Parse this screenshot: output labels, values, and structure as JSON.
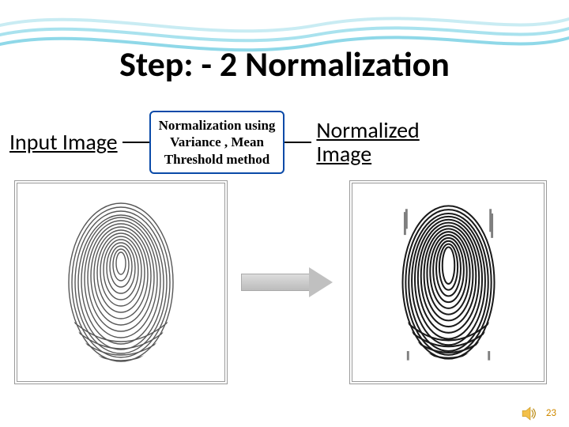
{
  "title": "Step: - 2 Normalization",
  "left_label": "Input Image",
  "method_box": {
    "line1": "Normalization using",
    "line2": "Variance , Mean",
    "line3": "Threshold method"
  },
  "right_label_line1": "Normalized",
  "right_label_line2": "Image",
  "page_number": "23",
  "icons": {
    "speaker": "speaker-icon",
    "arrow": "right-arrow-icon"
  },
  "colors": {
    "box_border": "#0a4aa8",
    "wave": "#7fcfe0",
    "page_num": "#d08a00"
  }
}
